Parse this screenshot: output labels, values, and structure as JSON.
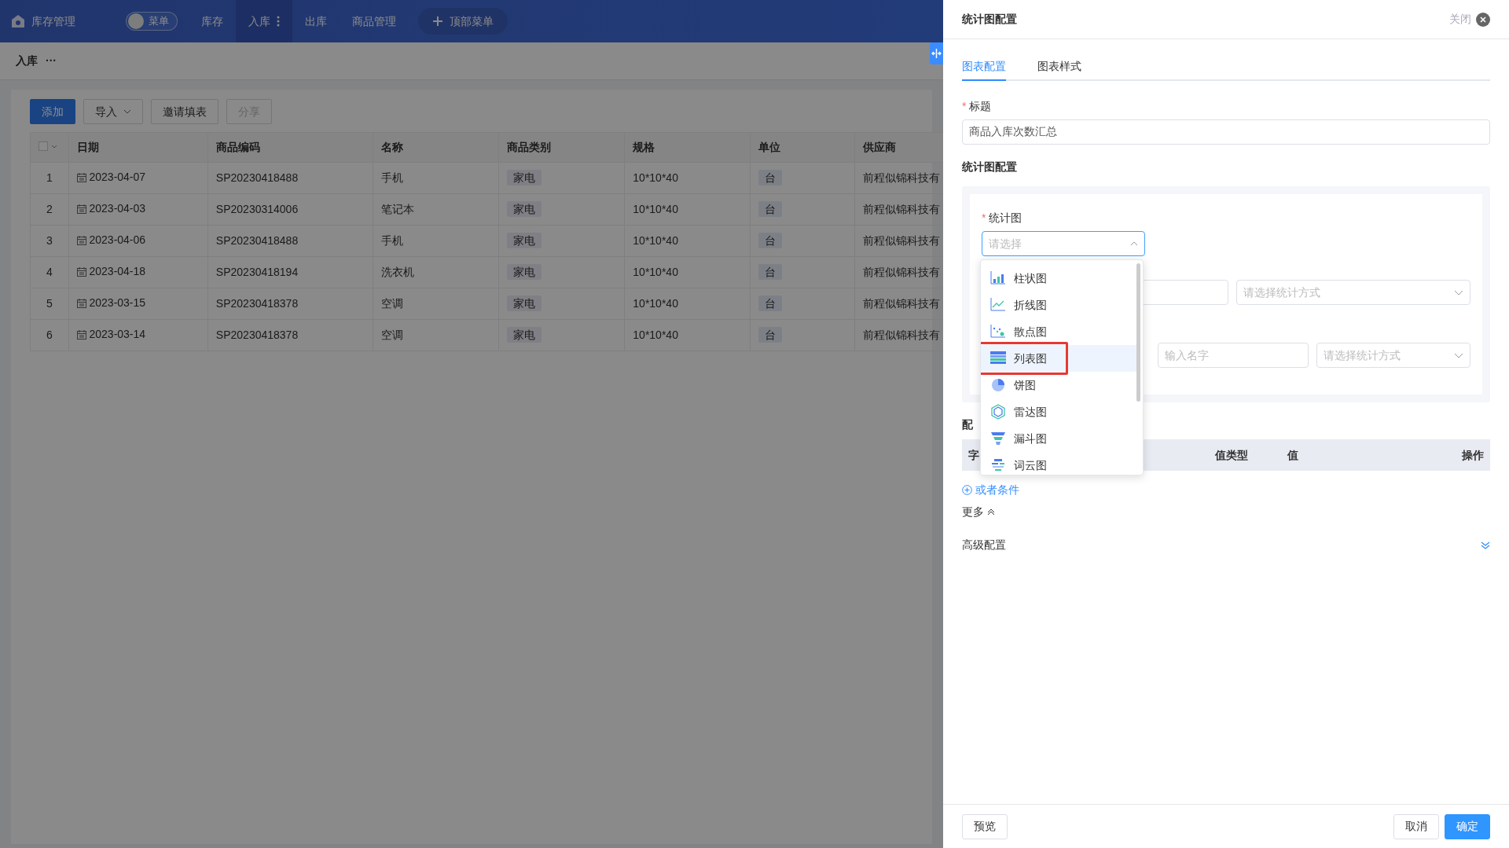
{
  "app": {
    "logo_text": "库存管理",
    "menu_toggle": {
      "label": "菜单",
      "on": false
    },
    "nav": [
      {
        "label": "库存",
        "selected": false,
        "has_more": false
      },
      {
        "label": "入库",
        "selected": true,
        "has_more": true
      },
      {
        "label": "出库",
        "selected": false,
        "has_more": false
      },
      {
        "label": "商品管理",
        "selected": false,
        "has_more": false
      }
    ],
    "add_menu": "顶部菜单",
    "breadcrumb": {
      "label": "入库",
      "more": "···"
    },
    "toolbar": [
      {
        "label": "添加",
        "kind": "primary"
      },
      {
        "label": "导入",
        "kind": "dropdown"
      },
      {
        "label": "邀请填表",
        "kind": "default"
      },
      {
        "label": "分享",
        "kind": "disabled"
      }
    ],
    "table": {
      "select_all": {
        "checked": false
      },
      "columns": [
        "日期",
        "商品编码",
        "名称",
        "商品类别",
        "规格",
        "单位",
        "供应商"
      ],
      "rows": [
        {
          "index": "1",
          "date": "2023-04-07",
          "code": "SP20230418488",
          "name": "手机",
          "category": "家电",
          "spec": "10*10*40",
          "unit": "台",
          "supplier": "前程似锦科技有"
        },
        {
          "index": "2",
          "date": "2023-04-03",
          "code": "SP20230314006",
          "name": "笔记本",
          "category": "家电",
          "spec": "10*10*40",
          "unit": "台",
          "supplier": "前程似锦科技有"
        },
        {
          "index": "3",
          "date": "2023-04-06",
          "code": "SP20230418488",
          "name": "手机",
          "category": "家电",
          "spec": "10*10*40",
          "unit": "台",
          "supplier": "前程似锦科技有"
        },
        {
          "index": "4",
          "date": "2023-04-18",
          "code": "SP20230418194",
          "name": "洗衣机",
          "category": "家电",
          "spec": "10*10*40",
          "unit": "台",
          "supplier": "前程似锦科技有"
        },
        {
          "index": "5",
          "date": "2023-03-15",
          "code": "SP20230418378",
          "name": "空调",
          "category": "家电",
          "spec": "10*10*40",
          "unit": "台",
          "supplier": "前程似锦科技有"
        },
        {
          "index": "6",
          "date": "2023-03-14",
          "code": "SP20230418378",
          "name": "空调",
          "category": "家电",
          "spec": "10*10*40",
          "unit": "台",
          "supplier": "前程似锦科技有"
        }
      ]
    }
  },
  "drawer": {
    "title": "统计图配置",
    "close_label": "关闭",
    "tabs": [
      {
        "label": "图表配置",
        "selected": true
      },
      {
        "label": "图表样式",
        "selected": false
      }
    ],
    "title_field": {
      "label": "标题",
      "required_mark": "*",
      "value": "商品入库次数汇总"
    },
    "section_title": "统计图配置",
    "chart_field": {
      "label": "统计图",
      "required_mark": "*",
      "placeholder": "请选择",
      "expanded": true
    },
    "row_1": {
      "select_placeholder": "请选择统计方式"
    },
    "row_2": {
      "input_placeholder": "输入名字",
      "select_placeholder": "请选择统计方式"
    },
    "dropdown": [
      {
        "label": "柱状图",
        "kind": "bar",
        "selected": false
      },
      {
        "label": "折线图",
        "kind": "line",
        "selected": false
      },
      {
        "label": "散点图",
        "kind": "scatter",
        "selected": false
      },
      {
        "label": "列表图",
        "kind": "table",
        "selected": true
      },
      {
        "label": "饼图",
        "kind": "pie",
        "selected": false
      },
      {
        "label": "雷达图",
        "kind": "radar",
        "selected": false
      },
      {
        "label": "漏斗图",
        "kind": "funnel",
        "selected": false
      },
      {
        "label": "词云图",
        "kind": "wordcloud",
        "selected": false
      }
    ],
    "config_label": "配",
    "condition_columns": [
      "字",
      "值类型",
      "值",
      "操作"
    ],
    "or_condition": "或者条件",
    "more": "更多",
    "advanced": "高级配置",
    "footer": {
      "preview": "预览",
      "cancel": "取消",
      "confirm": "确定"
    }
  }
}
